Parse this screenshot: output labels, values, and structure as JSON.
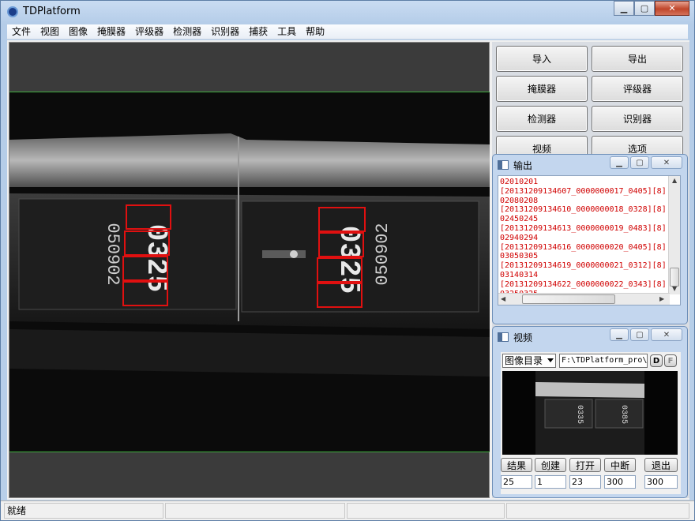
{
  "window": {
    "title": "TDPlatform"
  },
  "menu": [
    "文件",
    "视图",
    "图像",
    "掩膜器",
    "评级器",
    "检测器",
    "识别器",
    "捕获",
    "工具",
    "帮助"
  ],
  "buttons": [
    {
      "label": "导入",
      "name": "import-button"
    },
    {
      "label": "导出",
      "name": "export-button"
    },
    {
      "label": "掩膜器",
      "name": "masker-button"
    },
    {
      "label": "评级器",
      "name": "grader-button"
    },
    {
      "label": "检测器",
      "name": "detector-button"
    },
    {
      "label": "识别器",
      "name": "recognizer-button"
    },
    {
      "label": "视频",
      "name": "video-button"
    },
    {
      "label": "选项",
      "name": "options-button"
    }
  ],
  "output": {
    "title": "输出",
    "lines": [
      "02010201",
      "[20131209134607_0000000017_0405][8]",
      "02080208",
      "[20131209134610_0000000018_0328][8]",
      "02450245",
      "[20131209134613_0000000019_0483][8]",
      "02940294",
      "[20131209134616_0000000020_0405][8]",
      "03050305",
      "[20131209134619_0000000021_0312][8]",
      "03140314",
      "[20131209134622_0000000022_0343][8]",
      "03250325"
    ]
  },
  "video": {
    "title": "视频",
    "source_select": "图像目录",
    "path": "F:\\TDPlatform_pro\\",
    "d_label": "D",
    "f_label": "F",
    "controls": [
      "结果",
      "创建",
      "打开",
      "中断",
      "退出"
    ],
    "params": [
      "25",
      "1",
      "23",
      "300",
      "300"
    ]
  },
  "image": {
    "left_digits": "0325",
    "right_digits": "0325",
    "left_code": "050902",
    "right_code": "050902",
    "thumb_left": "0335",
    "thumb_right": "0385"
  },
  "status": {
    "text": "就绪"
  },
  "colors": {
    "detection_box": "#e01010",
    "roi_line": "#3fae3f",
    "output_text": "#d00000"
  },
  "icons": {
    "minimize": "minimize-icon",
    "maximize": "maximize-icon",
    "close": "close-icon"
  }
}
